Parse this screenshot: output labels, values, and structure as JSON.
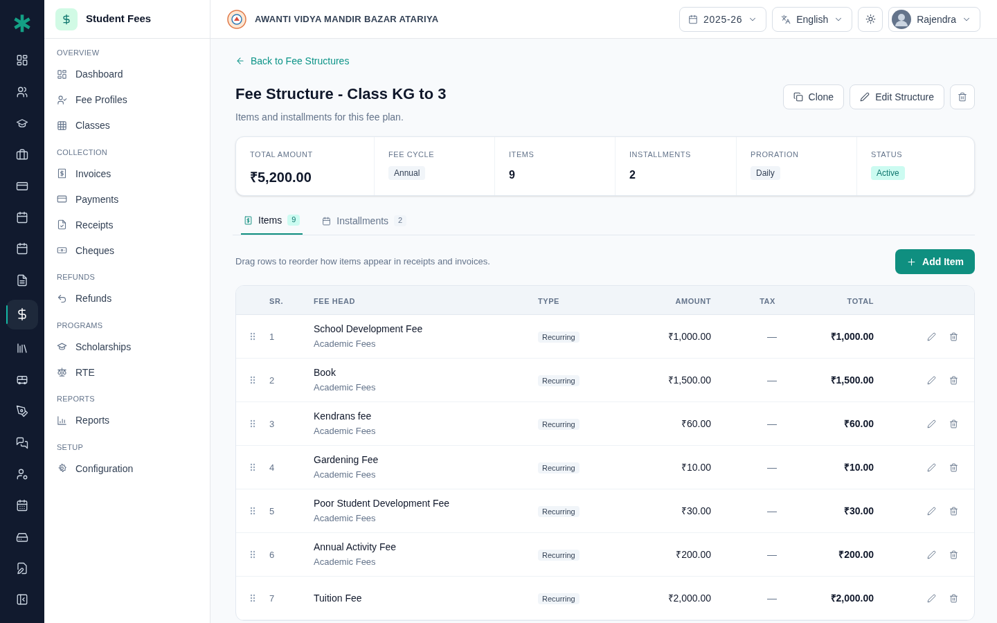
{
  "rail": [
    {
      "selected": false
    },
    {
      "selected": false
    },
    {
      "selected": false
    },
    {
      "selected": false
    },
    {
      "selected": false
    },
    {
      "selected": false
    },
    {
      "selected": false
    },
    {
      "selected": false
    },
    {
      "selected": true
    },
    {
      "selected": false
    },
    {
      "selected": false
    },
    {
      "selected": false
    },
    {
      "selected": false
    },
    {
      "selected": false
    },
    {
      "selected": false
    },
    {
      "selected": false
    },
    {
      "selected": false
    }
  ],
  "module": {
    "title": "Student Fees"
  },
  "sidebar": {
    "sections": [
      {
        "title": "OVERVIEW",
        "items": [
          {
            "label": "Dashboard"
          },
          {
            "label": "Fee Profiles"
          },
          {
            "label": "Classes"
          }
        ]
      },
      {
        "title": "COLLECTION",
        "items": [
          {
            "label": "Invoices"
          },
          {
            "label": "Payments"
          },
          {
            "label": "Receipts"
          },
          {
            "label": "Cheques"
          }
        ]
      },
      {
        "title": "REFUNDS",
        "items": [
          {
            "label": "Refunds"
          }
        ]
      },
      {
        "title": "PROGRAMS",
        "items": [
          {
            "label": "Scholarships"
          },
          {
            "label": "RTE"
          }
        ]
      },
      {
        "title": "REPORTS",
        "items": [
          {
            "label": "Reports"
          }
        ]
      },
      {
        "title": "SETUP",
        "items": [
          {
            "label": "Configuration"
          }
        ]
      }
    ]
  },
  "header": {
    "school": "AWANTI VIDYA MANDIR BAZAR ATARIYA",
    "year": "2025-26",
    "language": "English",
    "user": "Rajendra"
  },
  "back_link": "Back to Fee Structures",
  "page": {
    "title": "Fee Structure - Class KG to 3",
    "subtitle": "Items and installments for this fee plan.",
    "actions": [
      "Clone",
      "Edit Structure"
    ]
  },
  "summary": [
    {
      "label": "TOTAL AMOUNT",
      "value": "₹5,200.00",
      "kind": "big"
    },
    {
      "label": "FEE CYCLE",
      "value": "Annual",
      "kind": "badge"
    },
    {
      "label": "ITEMS",
      "value": "9",
      "kind": "number"
    },
    {
      "label": "INSTALLMENTS",
      "value": "2",
      "kind": "number"
    },
    {
      "label": "PRORATION",
      "value": "Daily",
      "kind": "badge"
    },
    {
      "label": "STATUS",
      "value": "Active",
      "kind": "status"
    }
  ],
  "tabs": [
    {
      "label": "Items",
      "count": "9",
      "selected": true
    },
    {
      "label": "Installments",
      "count": "2",
      "selected": false
    }
  ],
  "hint": "Drag rows to reorder how items appear in receipts and invoices.",
  "add_button": "Add Item",
  "table": {
    "columns": [
      "SR.",
      "FEE HEAD",
      "TYPE",
      "AMOUNT",
      "TAX",
      "TOTAL"
    ],
    "rows": [
      {
        "sr": "1",
        "name": "School Development Fee",
        "category": "Academic Fees",
        "type": "Recurring",
        "amount": "₹1,000.00",
        "tax": "—",
        "total": "₹1,000.00"
      },
      {
        "sr": "2",
        "name": "Book",
        "category": "Academic Fees",
        "type": "Recurring",
        "amount": "₹1,500.00",
        "tax": "—",
        "total": "₹1,500.00"
      },
      {
        "sr": "3",
        "name": "Kendrans fee",
        "category": "Academic Fees",
        "type": "Recurring",
        "amount": "₹60.00",
        "tax": "—",
        "total": "₹60.00"
      },
      {
        "sr": "4",
        "name": "Gardening Fee",
        "category": "Academic Fees",
        "type": "Recurring",
        "amount": "₹10.00",
        "tax": "—",
        "total": "₹10.00"
      },
      {
        "sr": "5",
        "name": "Poor Student Development Fee",
        "category": "Academic Fees",
        "type": "Recurring",
        "amount": "₹30.00",
        "tax": "—",
        "total": "₹30.00"
      },
      {
        "sr": "6",
        "name": "Annual Activity Fee",
        "category": "Academic Fees",
        "type": "Recurring",
        "amount": "₹200.00",
        "tax": "—",
        "total": "₹200.00"
      },
      {
        "sr": "7",
        "name": "Tuition Fee",
        "type": "Recurring",
        "amount": "₹2,000.00",
        "tax": "—",
        "total": "₹2,000.00"
      }
    ]
  }
}
